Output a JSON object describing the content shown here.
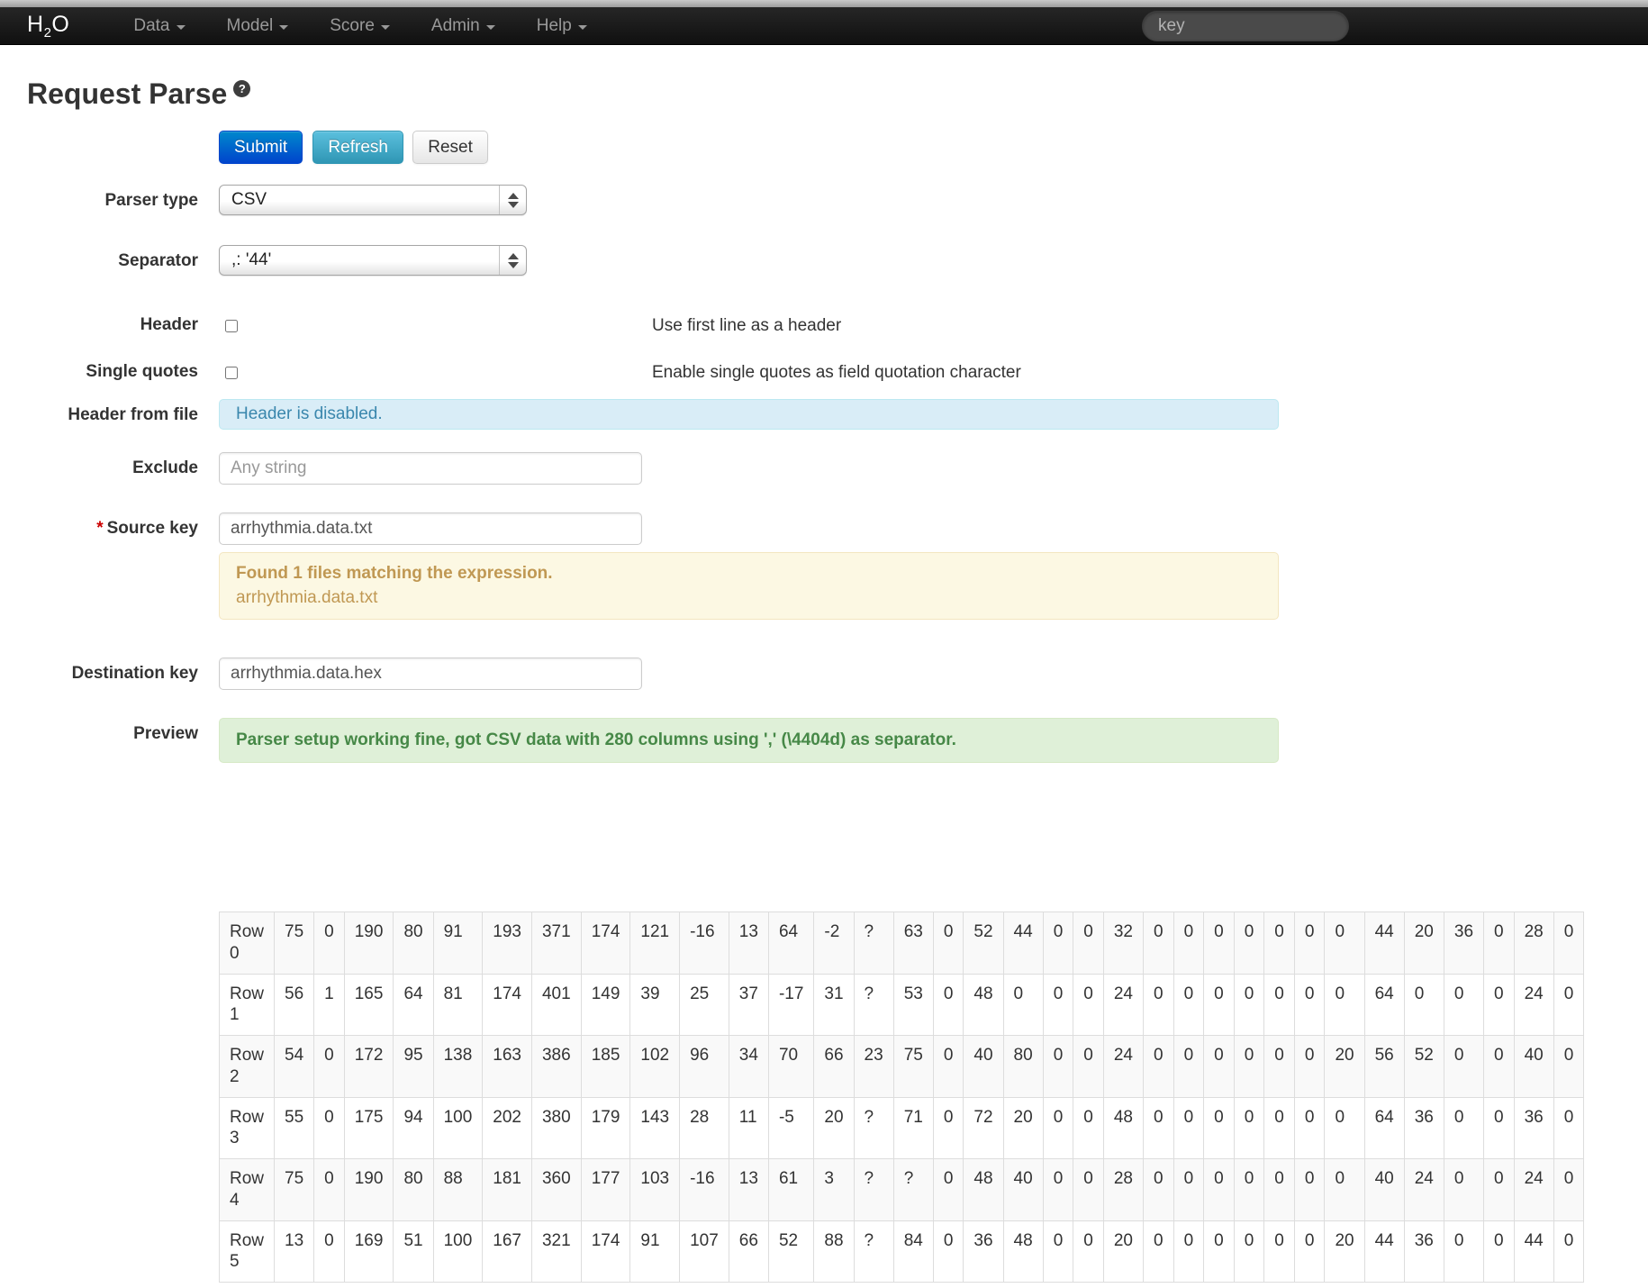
{
  "navbar": {
    "logo": {
      "pre": "H",
      "sub": "2",
      "post": "O"
    },
    "menus": [
      {
        "label": "Data"
      },
      {
        "label": "Model"
      },
      {
        "label": "Score"
      },
      {
        "label": "Admin"
      },
      {
        "label": "Help"
      }
    ],
    "search_placeholder": "key"
  },
  "page": {
    "title": "Request Parse",
    "help_badge": "?"
  },
  "toolbar": {
    "submit": "Submit",
    "refresh": "Refresh",
    "reset": "Reset"
  },
  "form": {
    "parser_type": {
      "label": "Parser type",
      "value": "CSV"
    },
    "separator": {
      "label": "Separator",
      "value": ",: '44'"
    },
    "header": {
      "label": "Header",
      "checked": false,
      "help": "Use first line as a header"
    },
    "single_quotes": {
      "label": "Single quotes",
      "checked": false,
      "help": "Enable single quotes as field quotation character"
    },
    "header_from_file": {
      "label": "Header from file",
      "info": "Header is disabled."
    },
    "exclude": {
      "label": "Exclude",
      "placeholder": "Any string"
    },
    "source_key": {
      "required_marker": "*",
      "label": "Source key",
      "value": "arrhythmia.data.txt",
      "warning_title": "Found 1 files matching the expression.",
      "warning_file": "arrhythmia.data.txt"
    },
    "destination_key": {
      "label": "Destination key",
      "value": "arrhythmia.data.hex"
    },
    "preview": {
      "label": "Preview",
      "message": "Parser setup working fine, got CSV data with 280 columns using ',' (\\4404d) as separator."
    }
  },
  "preview_table": {
    "rows": [
      {
        "label": "Row 0",
        "values": [
          75,
          0,
          190,
          80,
          91,
          193,
          371,
          174,
          121,
          -16,
          13,
          64,
          -2,
          "?",
          63,
          0,
          52,
          44,
          0,
          0,
          32,
          0,
          0,
          0,
          0,
          0,
          0,
          0,
          44,
          20,
          36,
          0,
          28,
          0
        ]
      },
      {
        "label": "Row 1",
        "values": [
          56,
          1,
          165,
          64,
          81,
          174,
          401,
          149,
          39,
          25,
          37,
          -17,
          31,
          "?",
          53,
          0,
          48,
          0,
          0,
          0,
          24,
          0,
          0,
          0,
          0,
          0,
          0,
          0,
          64,
          0,
          0,
          0,
          24,
          0
        ]
      },
      {
        "label": "Row 2",
        "values": [
          54,
          0,
          172,
          95,
          138,
          163,
          386,
          185,
          102,
          96,
          34,
          70,
          66,
          23,
          75,
          0,
          40,
          80,
          0,
          0,
          24,
          0,
          0,
          0,
          0,
          0,
          0,
          20,
          56,
          52,
          0,
          0,
          40,
          0
        ]
      },
      {
        "label": "Row 3",
        "values": [
          55,
          0,
          175,
          94,
          100,
          202,
          380,
          179,
          143,
          28,
          11,
          -5,
          20,
          "?",
          71,
          0,
          72,
          20,
          0,
          0,
          48,
          0,
          0,
          0,
          0,
          0,
          0,
          0,
          64,
          36,
          0,
          0,
          36,
          0
        ]
      },
      {
        "label": "Row 4",
        "values": [
          75,
          0,
          190,
          80,
          88,
          181,
          360,
          177,
          103,
          -16,
          13,
          61,
          3,
          "?",
          "?",
          0,
          48,
          40,
          0,
          0,
          28,
          0,
          0,
          0,
          0,
          0,
          0,
          0,
          40,
          24,
          0,
          0,
          24,
          0
        ]
      },
      {
        "label": "Row 5",
        "values": [
          13,
          0,
          169,
          51,
          100,
          167,
          321,
          174,
          91,
          107,
          66,
          52,
          88,
          "?",
          84,
          0,
          36,
          48,
          0,
          0,
          20,
          0,
          0,
          0,
          0,
          0,
          0,
          20,
          44,
          36,
          0,
          0,
          44,
          0
        ]
      }
    ]
  }
}
